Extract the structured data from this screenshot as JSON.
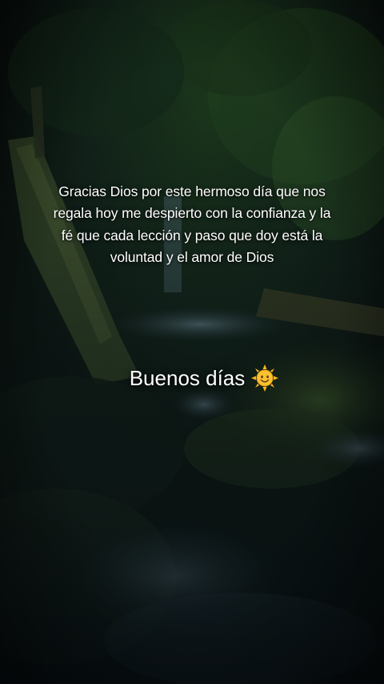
{
  "quote": {
    "text": "Gracias Dios por este hermoso día que nos regala hoy me despierto con la confianza y la fé que cada lección y paso que doy está la voluntad y el amor de Dios"
  },
  "greeting": {
    "text": "Buenos días",
    "emoji_icon": "smiling-sun-icon"
  },
  "colors": {
    "text": "#ffffff",
    "moss_green": "#3f5a2a",
    "dark_forest": "#0b120e",
    "water_blue": "#6f8ea0",
    "sun_yellow": "#f6b820"
  }
}
